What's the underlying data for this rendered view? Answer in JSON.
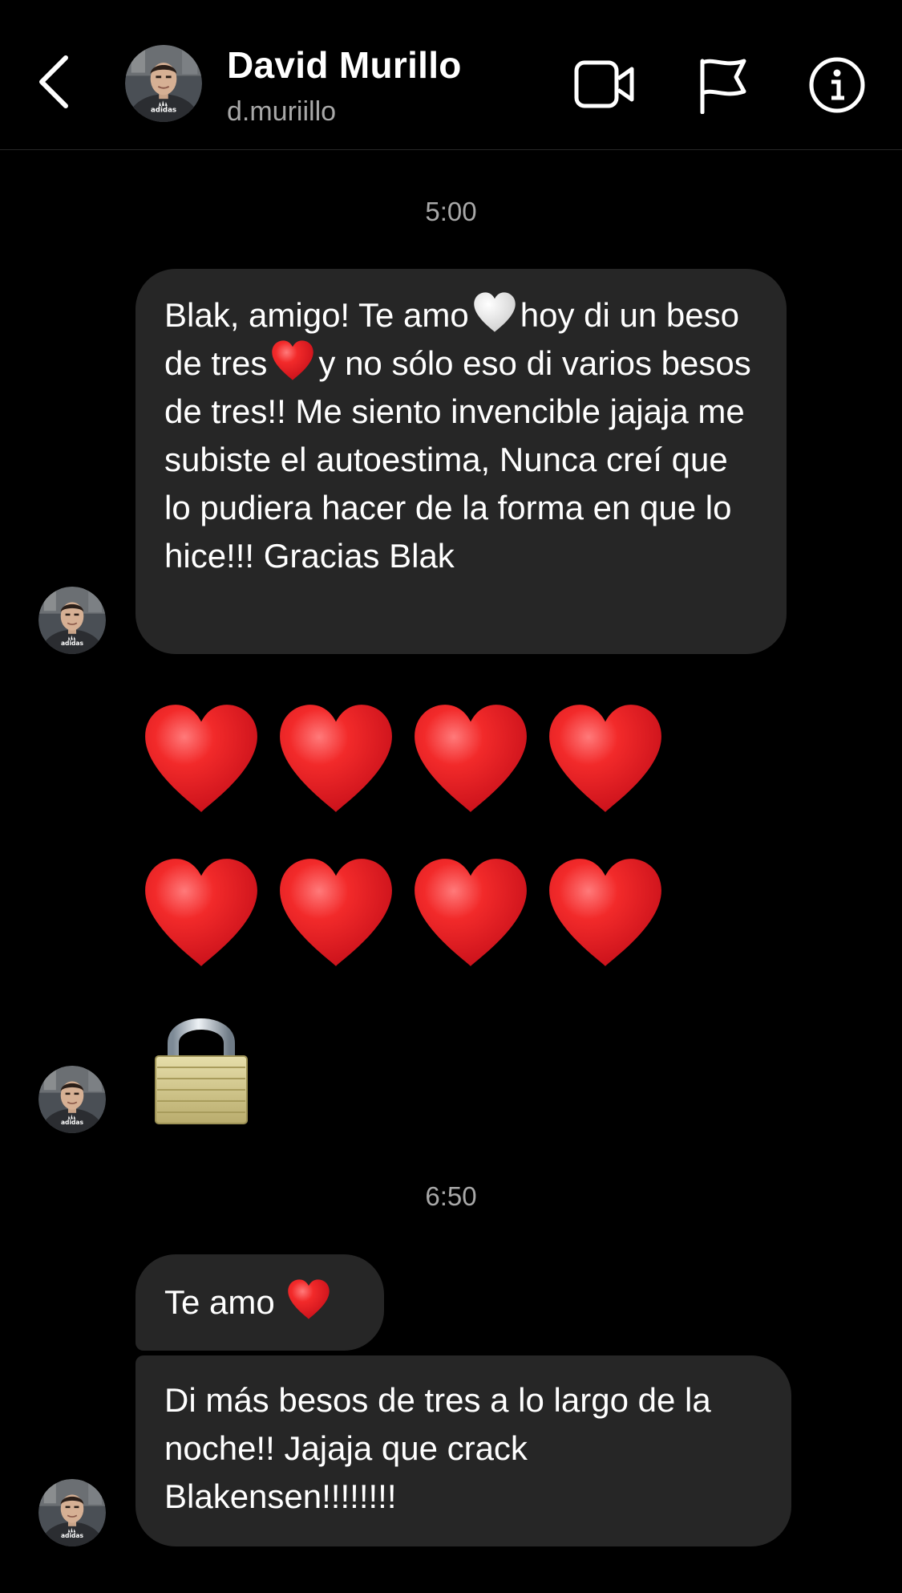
{
  "header": {
    "name": "David Murillo",
    "username": "d.muriillo"
  },
  "thread": {
    "timestamp_1": "5:00",
    "message_1": {
      "before_white_heart": "Blak, amigo! Te amo",
      "after_white_heart": "hoy di un beso de tres",
      "after_red_heart": "y no sólo eso di varios besos de tres!! Me siento invencible jajaja me subiste el autoestima, Nunca creí que lo pudiera hacer de la forma en que lo hice!!! Gracias Blak"
    },
    "big_hearts_count": 8,
    "lock_emoji": "lock",
    "timestamp_2": "6:50",
    "message_2": "Te amo",
    "message_3": "Di más besos de tres a lo largo de la noche!! Jajaja que crack Blakensen!!!!!!!!"
  },
  "icons": {
    "back": "chevron-left-icon",
    "video": "video-camera-icon",
    "flag": "flag-icon",
    "info": "info-icon"
  },
  "colors": {
    "background": "#000000",
    "bubble": "#262626",
    "secondary_text": "#a8a8a8",
    "heart": "#e8202a"
  }
}
